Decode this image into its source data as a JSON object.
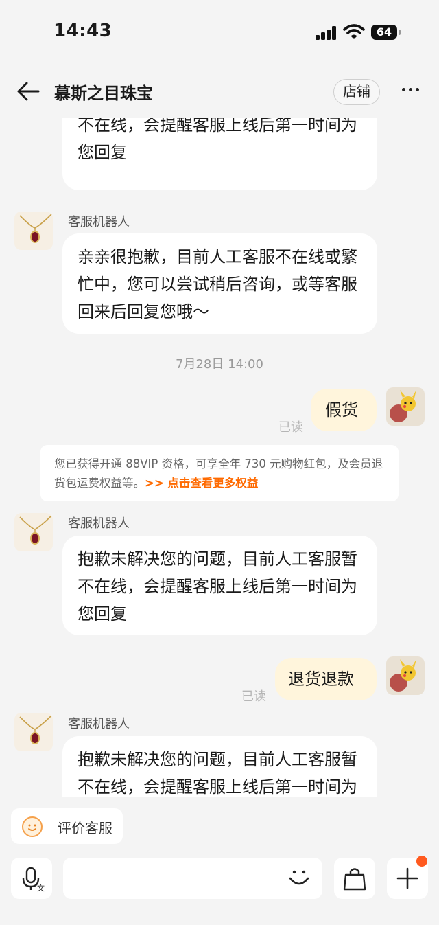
{
  "status_bar": {
    "time": "14:43",
    "battery": "64"
  },
  "header": {
    "title": "慕斯之目珠宝",
    "shop_label": "店铺"
  },
  "messages": {
    "top_partial": {
      "text": "抱歉未解决您的问题，目前人工客服暂不在线，会提醒客服上线后第一时间为您回复"
    },
    "bot1": {
      "sender": "客服机器人",
      "text": "亲亲很抱歉，目前人工客服不在线或繁忙中，您可以尝试稍后咨询，或等客服回来后回复您哦～"
    },
    "timestamp": "7月28日 14:00",
    "user1": {
      "text": "假货",
      "status": "已读"
    },
    "vip": {
      "text": "您已获得开通 88VIP 资格，可享全年 730 元购物红包，及会员退货包运费权益等。",
      "link": ">> 点击查看更多权益"
    },
    "bot2": {
      "sender": "客服机器人",
      "text": "抱歉未解决您的问题，目前人工客服暂不在线，会提醒客服上线后第一时间为您回复"
    },
    "user2": {
      "text": "退货退款",
      "status": "已读"
    },
    "bot3": {
      "sender": "客服机器人",
      "text": "抱歉未解决您的问题，目前人工客服暂不在线，会提醒客服上线后第一时间为您回复"
    }
  },
  "bottom": {
    "rate_label": "评价客服"
  },
  "icons": {
    "back": "back-arrow-icon",
    "more": "more-icon",
    "voice": "microphone-icon",
    "emoji": "smile-icon",
    "cart": "shopping-bag-icon",
    "plus": "plus-icon"
  },
  "colors": {
    "accent": "#ff6a00",
    "user_bubble": "#fff5dc",
    "badge_dot": "#ff5a1f"
  }
}
